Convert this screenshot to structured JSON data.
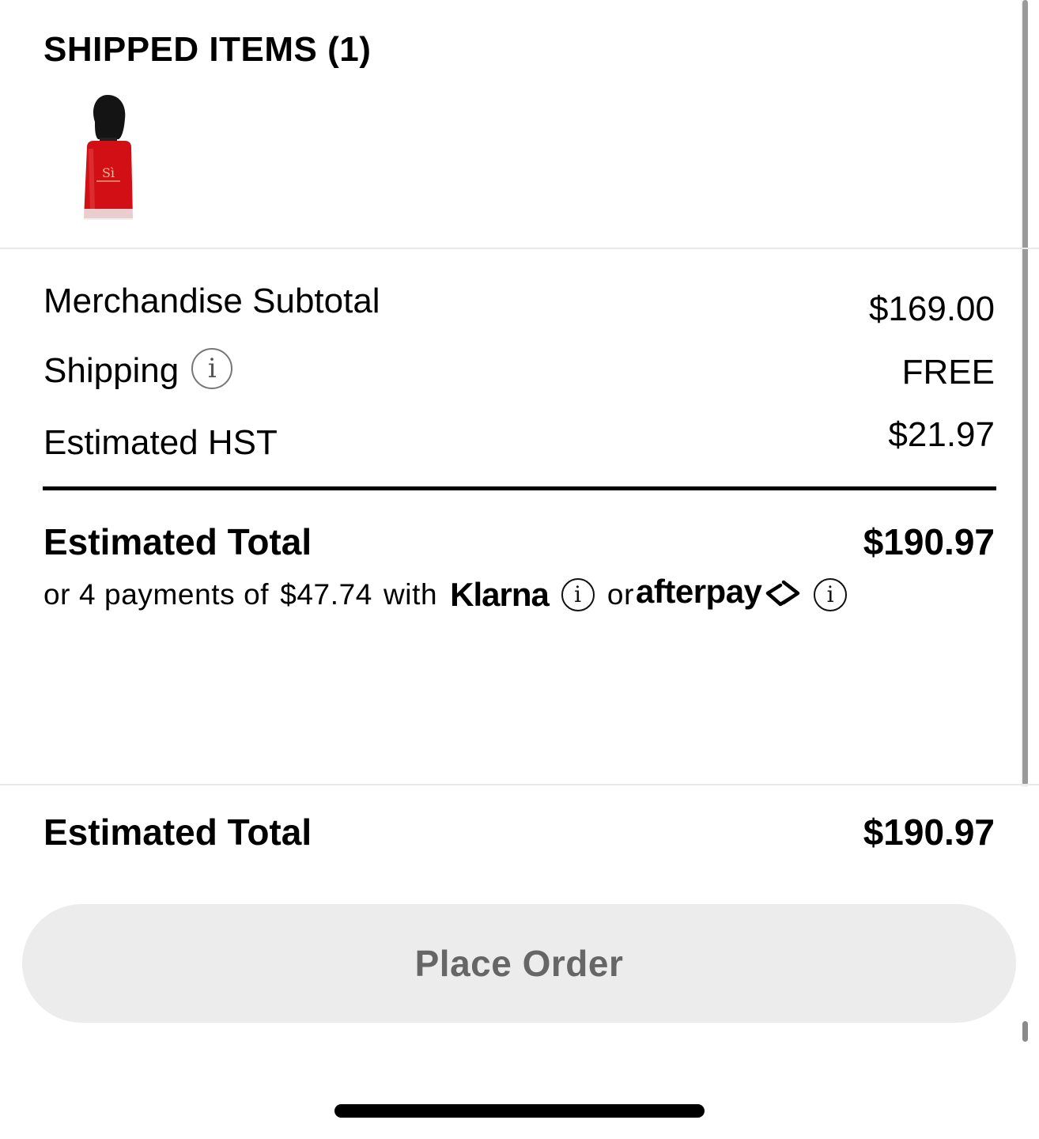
{
  "shipped_items": {
    "title": "SHIPPED ITEMS (1)",
    "product_image": "red-perfume-bottle"
  },
  "summary": {
    "merchandise_subtotal_label": "Merchandise Subtotal",
    "merchandise_subtotal_value": "$169.00",
    "shipping_label": "Shipping",
    "shipping_value": "FREE",
    "hst_label": "Estimated HST",
    "hst_value": "$21.97",
    "total_label": "Estimated Total",
    "total_value": "$190.97"
  },
  "installments": {
    "prefix": "or 4 payments of",
    "amount": "$47.74",
    "with": "with",
    "klarna": "Klarna",
    "or": "or",
    "afterpay": "afterpay"
  },
  "footer": {
    "total_label": "Estimated Total",
    "total_value": "$190.97",
    "place_order": "Place Order"
  },
  "icons": {
    "info": "i"
  },
  "colors": {
    "button_bg": "#ececec",
    "button_text": "#666666",
    "divider": "#000000"
  }
}
